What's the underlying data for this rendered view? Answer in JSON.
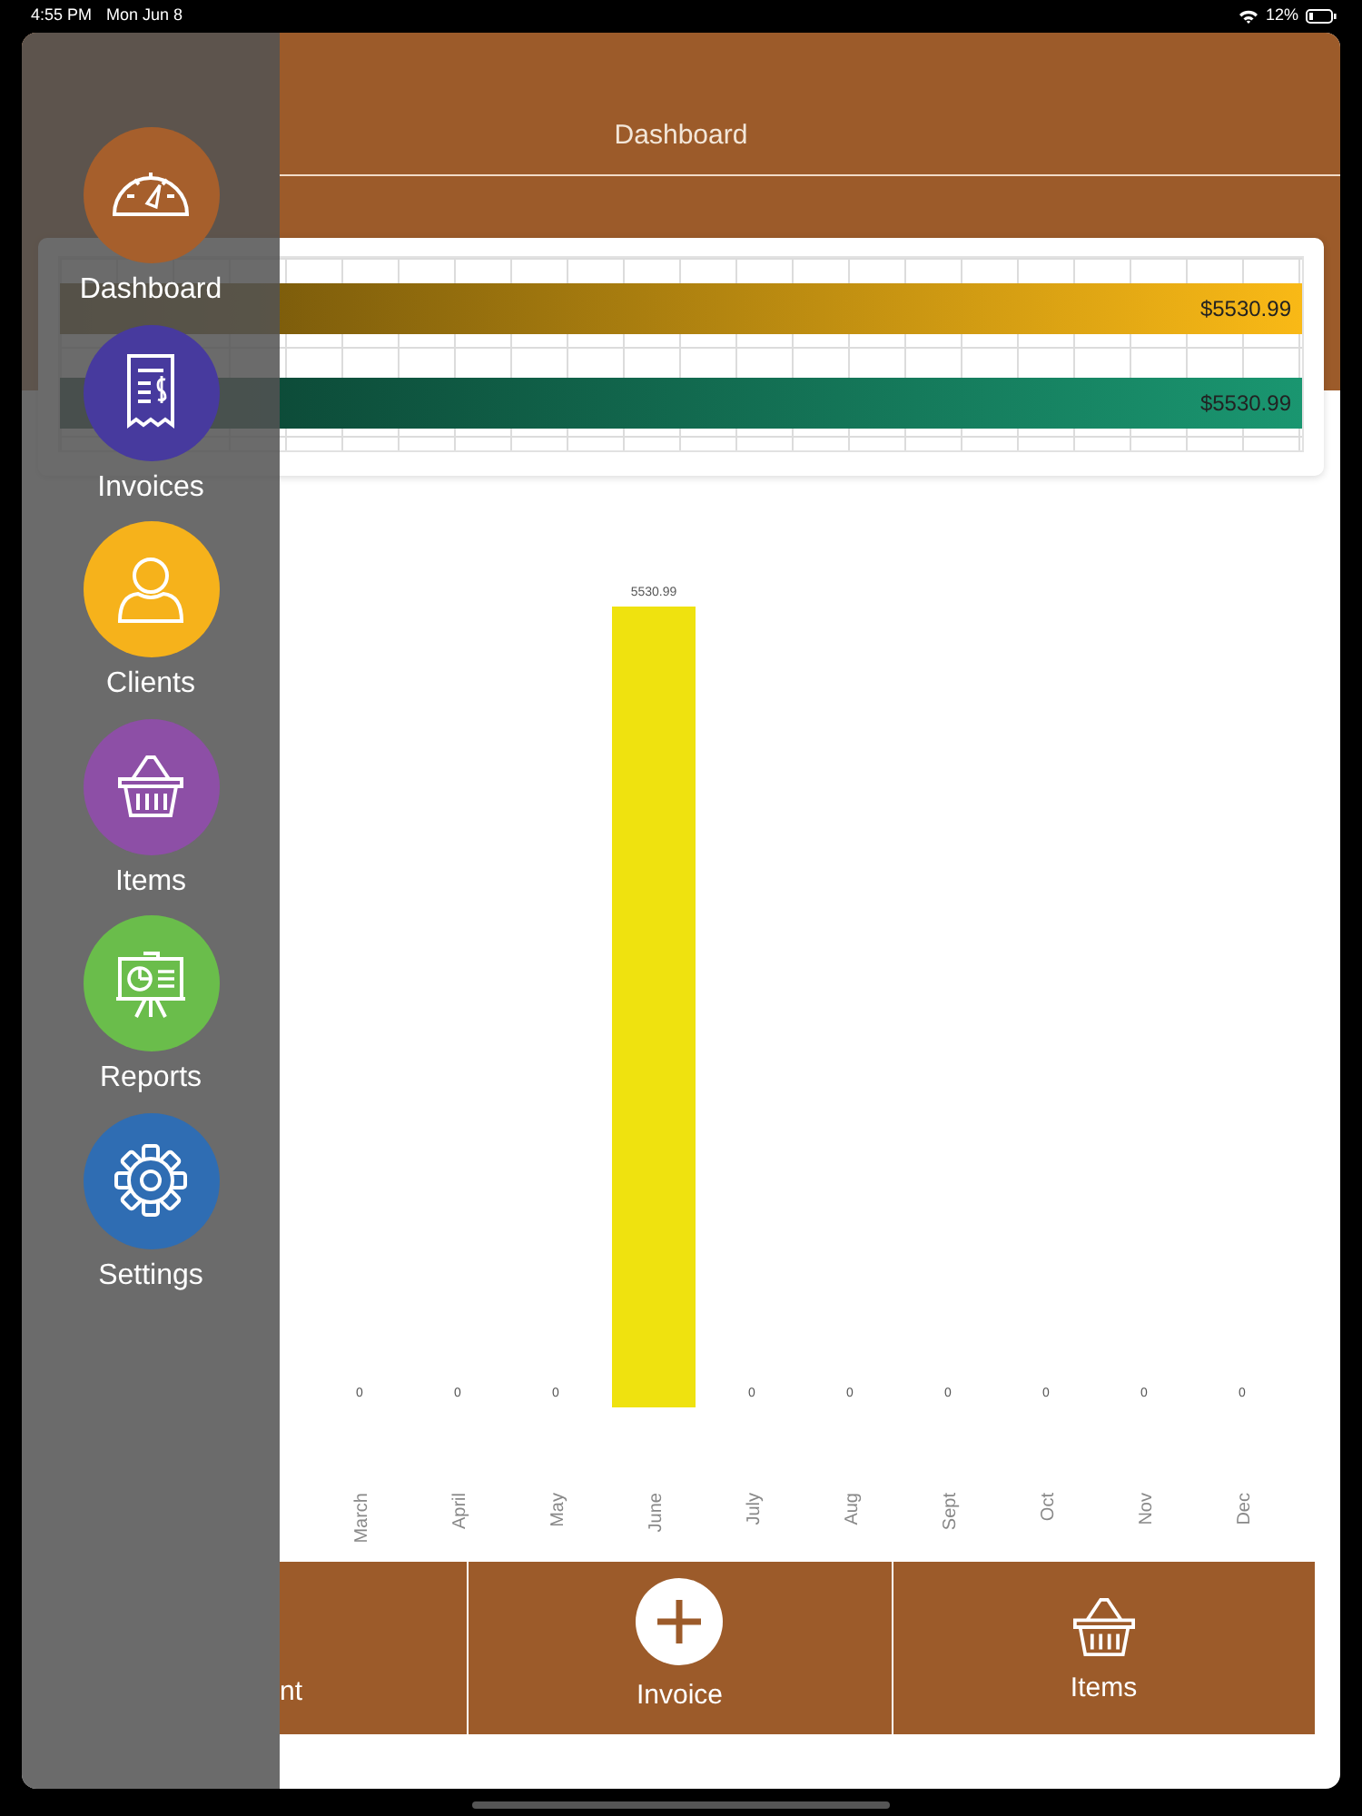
{
  "status_bar": {
    "time": "4:55 PM",
    "date": "Mon Jun 8",
    "battery": "12%"
  },
  "header": {
    "title": "Dashboard"
  },
  "summary_bars": [
    {
      "amount": "$5530.99",
      "level": 1,
      "color": "#f9b916"
    },
    {
      "amount": "$5530.99",
      "level": 1,
      "color": "#1a9670"
    }
  ],
  "monthly_chart": {
    "chart_data": {
      "type": "bar",
      "categories": [
        "March",
        "April",
        "May",
        "June",
        "July",
        "Aug",
        "Sept",
        "Oct",
        "Nov",
        "Dec"
      ],
      "values": [
        0,
        0,
        0,
        5530.99,
        0,
        0,
        0,
        0,
        0,
        0
      ],
      "data_labels": true,
      "color": "#efe20f"
    }
  },
  "bottom_bar": [
    {
      "kind": "plain",
      "label": "nt"
    },
    {
      "kind": "add",
      "label": "Invoice"
    },
    {
      "kind": "basket",
      "label": "Items"
    }
  ],
  "sidebar": {
    "items": [
      {
        "label": "Dashboard",
        "kind": "gauge",
        "color": "#a65f2c"
      },
      {
        "label": "Invoices",
        "kind": "receipt",
        "color": "#473a9e"
      },
      {
        "label": "Clients",
        "kind": "person",
        "color": "#f6b21b"
      },
      {
        "label": "Items",
        "kind": "basket",
        "color": "#8d4fa6"
      },
      {
        "label": "Reports",
        "kind": "board",
        "color": "#6abd4b"
      },
      {
        "label": "Settings",
        "kind": "gear",
        "color": "#2f6db3"
      }
    ]
  }
}
